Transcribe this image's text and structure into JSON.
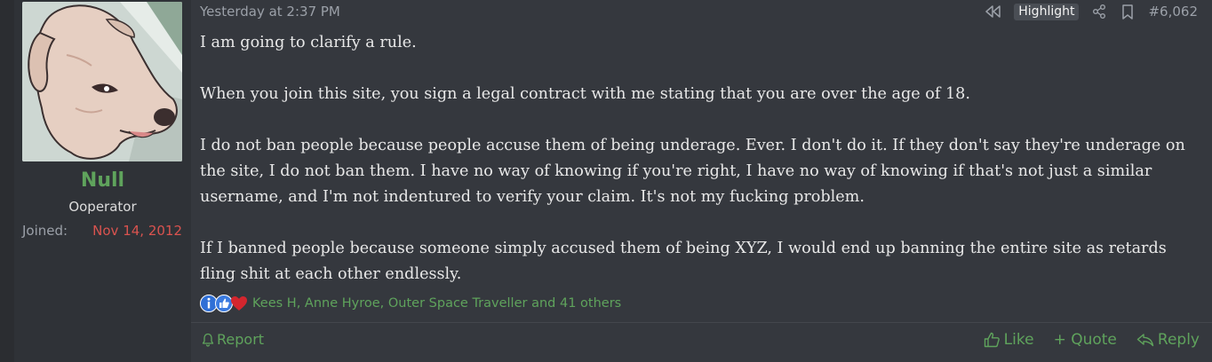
{
  "user": {
    "name": "Null",
    "title": "Ooperator",
    "joined_label": "Joined:",
    "joined_value": "Nov 14, 2012"
  },
  "post": {
    "timestamp": "Yesterday at 2:37 PM",
    "tools": {
      "highlight_label": "Highlight",
      "post_number": "#6,062"
    },
    "paragraphs": [
      "I am going to clarify a rule.",
      "When you join this site, you sign a legal contract with me stating that you are over the age of 18.",
      "I do not ban people because people accuse them of being underage. Ever. I don't do it. If they don't say they're underage on the site, I do not ban them. I have no way of knowing if you're right, I have no way of knowing if that's not just a similar username, and I'm not indentured to verify your claim. It's not my fucking problem.",
      "If I banned people because someone simply accused them of being XYZ, I would end up banning the entire site as retards fling shit at each other endlessly."
    ],
    "reactions": {
      "icons": [
        "informative-icon",
        "like-icon",
        "heart-icon"
      ],
      "summary": "Kees H, Anne Hyroe, Outer Space Traveller and 41 others"
    },
    "footer": {
      "report_label": "Report",
      "like_label": "Like",
      "quote_label": "+ Quote",
      "reply_label": "Reply"
    }
  },
  "colors": {
    "accent_green": "#5fa35c",
    "joined_red": "#d9534f"
  }
}
